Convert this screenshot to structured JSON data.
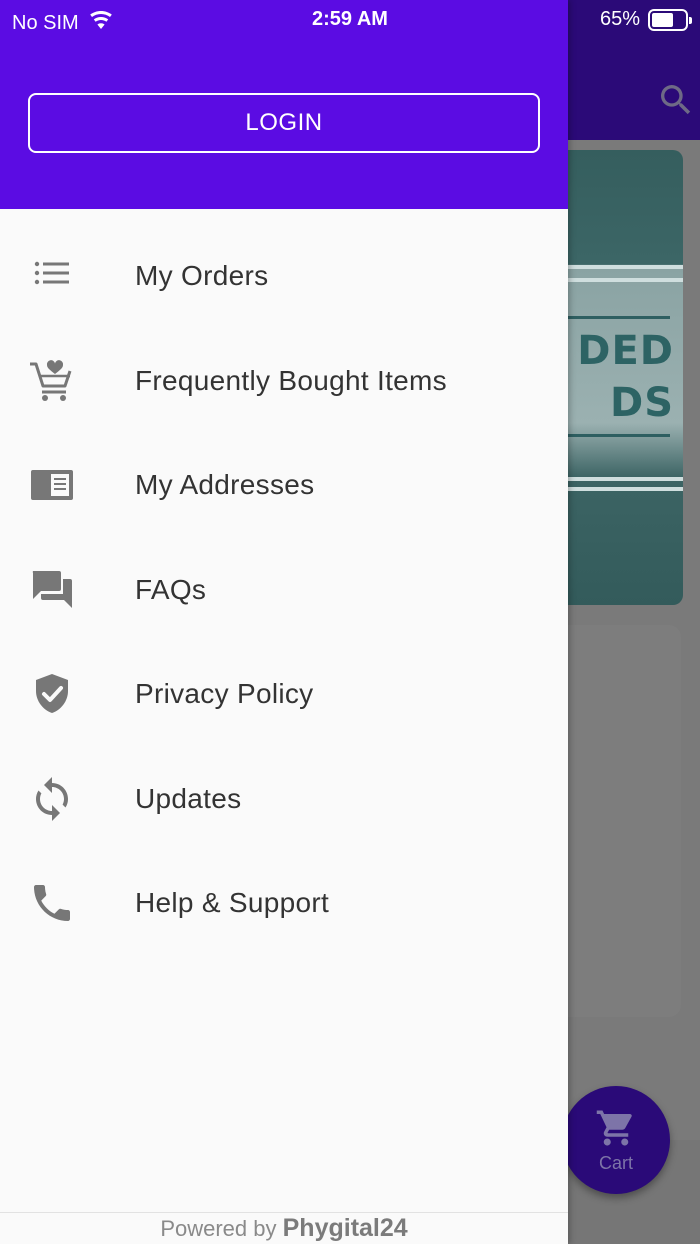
{
  "status_bar": {
    "carrier": "No SIM",
    "time": "2:59 AM",
    "battery": "65%",
    "battery_level": 0.65
  },
  "background": {
    "banner_text_line1": "DED",
    "banner_text_line2": "DS",
    "cart_label": "Cart"
  },
  "drawer": {
    "login_label": "LOGIN",
    "header_color": "#5b0ce3",
    "items": [
      {
        "label": "My Orders",
        "icon": "list-icon"
      },
      {
        "label": "Frequently Bought Items",
        "icon": "cart-heart-icon"
      },
      {
        "label": "My Addresses",
        "icon": "address-book-icon"
      },
      {
        "label": "FAQs",
        "icon": "forum-icon"
      },
      {
        "label": "Privacy Policy",
        "icon": "shield-check-icon"
      },
      {
        "label": "Updates",
        "icon": "sync-icon"
      },
      {
        "label": "Help & Support",
        "icon": "phone-icon"
      }
    ],
    "footer_prefix": "Powered by",
    "footer_brand": "Phygital24"
  }
}
